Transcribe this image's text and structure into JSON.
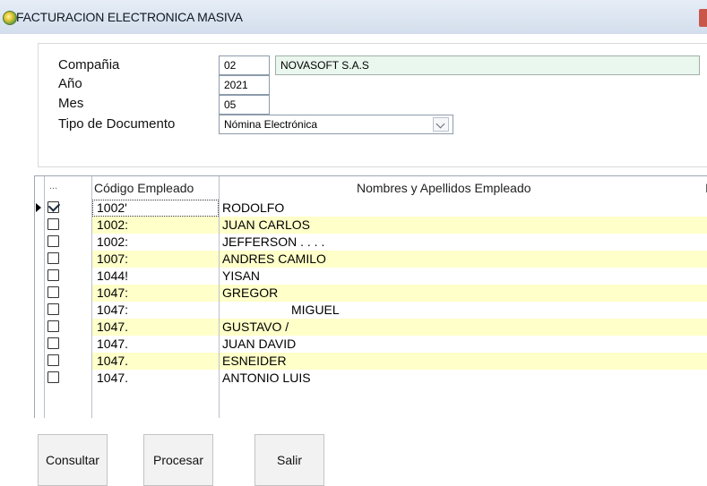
{
  "window": {
    "title": "FACTURACION ELECTRONICA MASIVA"
  },
  "header": {
    "company_label": "Compañia",
    "company_code": "02",
    "company_name": "NOVASOFT S.A.S",
    "year_label": "Año",
    "year_value": "2021",
    "month_label": "Mes",
    "month_value": "05",
    "doc_type_label": "Tipo de Documento",
    "doc_type_value": "Nómina Electrónica"
  },
  "grid": {
    "columns": [
      "...",
      "Código Empleado",
      "Nombres y Apellidos Empleado",
      "I"
    ],
    "rows": [
      {
        "code": "1002'",
        "name": "RODOLFO",
        "checked": true,
        "current": true
      },
      {
        "code": "1002:",
        "name": "JUAN CARLOS",
        "checked": false
      },
      {
        "code": "1002:",
        "name": "JEFFERSON . . . .",
        "checked": false
      },
      {
        "code": "1007:",
        "name": "ANDRES CAMILO",
        "checked": false
      },
      {
        "code": "1044!",
        "name": "YISAN",
        "checked": false
      },
      {
        "code": "1047:",
        "name": "GREGOR",
        "checked": false
      },
      {
        "code": "1047:",
        "name": "MIGUEL",
        "checked": false
      },
      {
        "code": "1047.",
        "name": "GUSTAVO /",
        "checked": false
      },
      {
        "code": "1047.",
        "name": "JUAN DAVID",
        "checked": false
      },
      {
        "code": "1047.",
        "name": "ESNEIDER",
        "checked": false
      },
      {
        "code": "1047.",
        "name": "ANTONIO LUIS",
        "checked": false
      }
    ]
  },
  "buttons": {
    "consultar": "Consultar",
    "procesar": "Procesar",
    "salir": "Salir"
  },
  "colors": {
    "alt_row": "#ffffc9",
    "name_field": "#eaf7ee",
    "titlebar": "#d3deec"
  }
}
